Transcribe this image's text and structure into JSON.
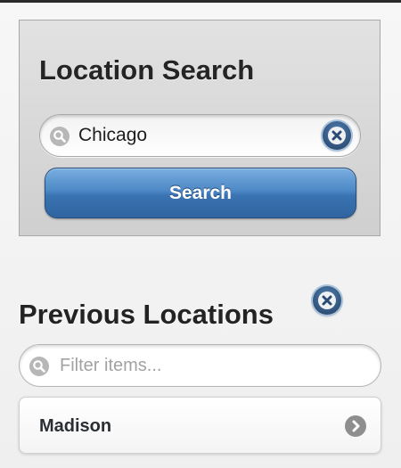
{
  "search_panel": {
    "title": "Location Search",
    "input_value": "Chicago",
    "button_label": "Search"
  },
  "previous_locations": {
    "title": "Previous Locations",
    "filter_placeholder": "Filter items...",
    "items": [
      {
        "label": "Madison"
      }
    ]
  },
  "icons": {
    "search": "search-icon",
    "clear": "clear-icon",
    "arrow": "chevron-right-icon"
  },
  "colors": {
    "accent": "#3a73b1",
    "clear_button": "#2f5583"
  }
}
